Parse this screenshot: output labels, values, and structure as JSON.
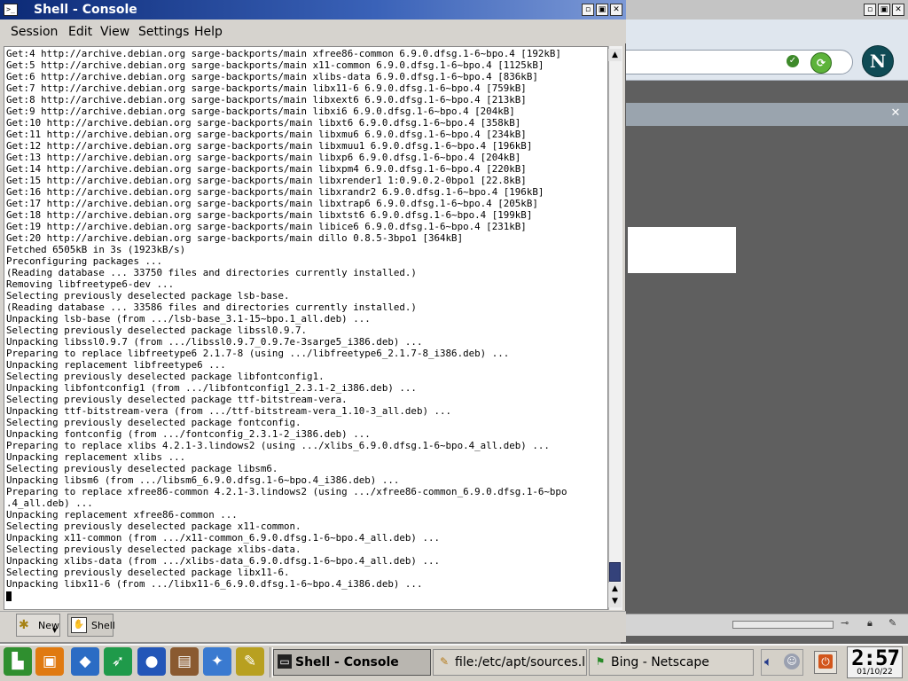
{
  "console": {
    "title": "Shell - Console",
    "menu": [
      "Session",
      "Edit",
      "View",
      "Settings",
      "Help"
    ],
    "session_tabs": [
      {
        "label": "New",
        "icon": "new-session-icon"
      },
      {
        "label": "Shell",
        "icon": "shell-icon"
      }
    ],
    "terminal_lines": [
      "Get:4 http://archive.debian.org sarge-backports/main xfree86-common 6.9.0.dfsg.1-6~bpo.4 [192kB]",
      "Get:5 http://archive.debian.org sarge-backports/main x11-common 6.9.0.dfsg.1-6~bpo.4 [1125kB]",
      "Get:6 http://archive.debian.org sarge-backports/main xlibs-data 6.9.0.dfsg.1-6~bpo.4 [836kB]",
      "Get:7 http://archive.debian.org sarge-backports/main libx11-6 6.9.0.dfsg.1-6~bpo.4 [759kB]",
      "Get:8 http://archive.debian.org sarge-backports/main libxext6 6.9.0.dfsg.1-6~bpo.4 [213kB]",
      "Get:9 http://archive.debian.org sarge-backports/main libxi6 6.9.0.dfsg.1-6~bpo.4 [204kB]",
      "Get:10 http://archive.debian.org sarge-backports/main libxt6 6.9.0.dfsg.1-6~bpo.4 [358kB]",
      "Get:11 http://archive.debian.org sarge-backports/main libxmu6 6.9.0.dfsg.1-6~bpo.4 [234kB]",
      "Get:12 http://archive.debian.org sarge-backports/main libxmuu1 6.9.0.dfsg.1-6~bpo.4 [196kB]",
      "Get:13 http://archive.debian.org sarge-backports/main libxp6 6.9.0.dfsg.1-6~bpo.4 [204kB]",
      "Get:14 http://archive.debian.org sarge-backports/main libxpm4 6.9.0.dfsg.1-6~bpo.4 [220kB]",
      "Get:15 http://archive.debian.org sarge-backports/main libxrender1 1:0.9.0.2-0bpo1 [22.8kB]",
      "Get:16 http://archive.debian.org sarge-backports/main libxrandr2 6.9.0.dfsg.1-6~bpo.4 [196kB]",
      "Get:17 http://archive.debian.org sarge-backports/main libxtrap6 6.9.0.dfsg.1-6~bpo.4 [205kB]",
      "Get:18 http://archive.debian.org sarge-backports/main libxtst6 6.9.0.dfsg.1-6~bpo.4 [199kB]",
      "Get:19 http://archive.debian.org sarge-backports/main libice6 6.9.0.dfsg.1-6~bpo.4 [231kB]",
      "Get:20 http://archive.debian.org sarge-backports/main dillo 0.8.5-3bpo1 [364kB]",
      "Fetched 6505kB in 3s (1923kB/s)",
      "Preconfiguring packages ...",
      "(Reading database ... 33750 files and directories currently installed.)",
      "Removing libfreetype6-dev ...",
      "Selecting previously deselected package lsb-base.",
      "(Reading database ... 33586 files and directories currently installed.)",
      "Unpacking lsb-base (from .../lsb-base_3.1-15~bpo.1_all.deb) ...",
      "Selecting previously deselected package libssl0.9.7.",
      "Unpacking libssl0.9.7 (from .../libssl0.9.7_0.9.7e-3sarge5_i386.deb) ...",
      "Preparing to replace libfreetype6 2.1.7-8 (using .../libfreetype6_2.1.7-8_i386.deb) ...",
      "Unpacking replacement libfreetype6 ...",
      "Selecting previously deselected package libfontconfig1.",
      "Unpacking libfontconfig1 (from .../libfontconfig1_2.3.1-2_i386.deb) ...",
      "Selecting previously deselected package ttf-bitstream-vera.",
      "Unpacking ttf-bitstream-vera (from .../ttf-bitstream-vera_1.10-3_all.deb) ...",
      "Selecting previously deselected package fontconfig.",
      "Unpacking fontconfig (from .../fontconfig_2.3.1-2_i386.deb) ...",
      "Preparing to replace xlibs 4.2.1-3.lindows2 (using .../xlibs_6.9.0.dfsg.1-6~bpo.4_all.deb) ...",
      "Unpacking replacement xlibs ...",
      "Selecting previously deselected package libsm6.",
      "Unpacking libsm6 (from .../libsm6_6.9.0.dfsg.1-6~bpo.4_i386.deb) ...",
      "Preparing to replace xfree86-common 4.2.1-3.lindows2 (using .../xfree86-common_6.9.0.dfsg.1-6~bpo",
      ".4_all.deb) ...",
      "Unpacking replacement xfree86-common ...",
      "Selecting previously deselected package x11-common.",
      "Unpacking x11-common (from .../x11-common_6.9.0.dfsg.1-6~bpo.4_all.deb) ...",
      "Selecting previously deselected package xlibs-data.",
      "Unpacking xlibs-data (from .../xlibs-data_6.9.0.dfsg.1-6~bpo.4_all.deb) ...",
      "Selecting previously deselected package libx11-6.",
      "Unpacking libx11-6 (from .../libx11-6_6.9.0.dfsg.1-6~bpo.4_i386.deb) ..."
    ]
  },
  "taskbar": {
    "launchers": [
      {
        "name": "start-menu-icon",
        "glyph": "▙",
        "color": "#2f8f2f"
      },
      {
        "name": "life-jacket-icon",
        "glyph": "▣",
        "color": "#e07a10"
      },
      {
        "name": "cube-icon",
        "glyph": "◆",
        "color": "#2b6cc4"
      },
      {
        "name": "runner-icon",
        "glyph": "➶",
        "color": "#1f9a4a"
      },
      {
        "name": "globe-icon",
        "glyph": "●",
        "color": "#2356b8"
      },
      {
        "name": "printer-icon",
        "glyph": "▤",
        "color": "#8a5a30"
      },
      {
        "name": "chart-icon",
        "glyph": "✦",
        "color": "#3a7ad0"
      },
      {
        "name": "broom-icon",
        "glyph": "✎",
        "color": "#b8a020"
      }
    ],
    "tasks": [
      {
        "label": "Shell - Console",
        "icon": "terminal-icon",
        "active": true
      },
      {
        "label": "file:/etc/apt/sources.list",
        "icon": "edit-icon",
        "active": false
      },
      {
        "label": "Bing - Netscape",
        "icon": "netscape-icon",
        "active": false
      }
    ],
    "clock": {
      "time": "2:57",
      "date": "01/10/22"
    }
  },
  "background_window": {
    "app": "Netscape",
    "logo_letter": "N"
  }
}
